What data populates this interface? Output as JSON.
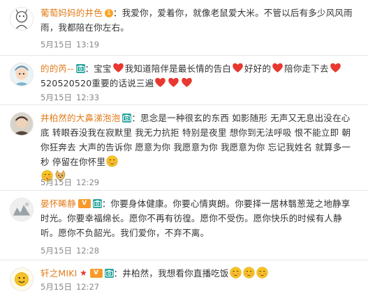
{
  "comments": [
    {
      "user": "葡萄妈妈的井色",
      "sep": "：",
      "text_main": "我爱你，爱着你，就像老鼠爱大米。不管以后有多少风风雨雨，我都陪在你左右。",
      "date": "5月15日",
      "time": "13:19"
    },
    {
      "user": "的的芮--",
      "sep": "：",
      "text_a": "宝宝",
      "text_b": "我知道陪伴是最长情的告白",
      "text_c": "好好的",
      "text_d": "陪你走下去",
      "text_e": "520520520重要的话说三遍",
      "date": "5月15日",
      "time": "12:33"
    },
    {
      "user": "井柏然的大鼻涕泡泡",
      "sep": "：",
      "text_main": "思念是一种很玄的东西 如影随形 无声又无息出没在心底 转眼吞没我在寂默里 我无力抗拒 特别是夜里 想你到无法呼吸 恨不能立即 朝你狂奔去 大声的告诉你 愿意为你 我愿意为你 我愿意为你 忘记我姓名 就算多一秒 停留在你怀里",
      "date": "5月15日",
      "time": "12:29"
    },
    {
      "user": "晏怀睎静",
      "sep": "：",
      "text_main": "你要身体健康。你要心情爽朗。你要择一居林翳葱茏之地静享时光。你要幸福绵长。愿你不再有彷徨。愿你不受伤。愿你快乐的时候有人静听。愿你不负韶光。我们爱你，不弃不离。",
      "date": "5月15日",
      "time": "12:28"
    },
    {
      "user": "轩之MIKI",
      "sep": "：",
      "text_main": "井柏然，我想看你直播吃饭",
      "date": "5月15日",
      "time": "12:27"
    }
  ],
  "colors": {
    "username": "#e17d1c",
    "text": "#333333",
    "meta": "#888888",
    "heart": "#e8382f",
    "emoji_face": "#f7c325",
    "badge_teal": "#2ba7a0",
    "badge_vip": "#f89a2b"
  },
  "icons": {
    "camera_badge": "camera-badge-icon",
    "vip_badge": "vip-badge-icon",
    "heart": "heart-emoji-icon",
    "shy_face": "shy-face-emoji-icon",
    "kiss_face": "kiss-face-emoji-icon",
    "dog": "doge-emoji-icon"
  },
  "badges": {
    "level": "1",
    "vip": "V",
    "crown": "♛",
    "star": "★"
  }
}
